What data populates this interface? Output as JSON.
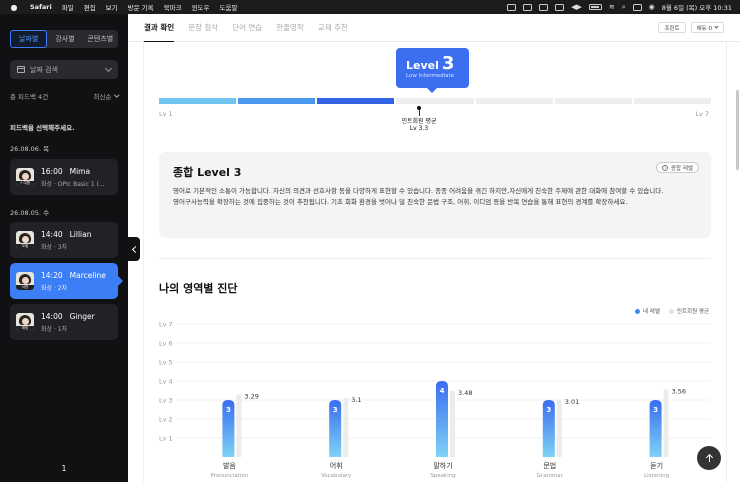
{
  "menubar": {
    "items": [
      "Safari",
      "파일",
      "편집",
      "보기",
      "방문 기록",
      "북마크",
      "윈도우",
      "도움말"
    ],
    "clock": "8월 6일 (목) 오후 10:31",
    "status_icons": [
      "screen-icon",
      "notebook-icon",
      "n-icon",
      "mail-icon",
      "playback-icon",
      "battery-icon",
      "wifi-icon",
      "search-icon",
      "control-center-icon",
      "siri-icon"
    ]
  },
  "sidebar": {
    "tabs": [
      "날짜별",
      "강사별",
      "콘텐츠별"
    ],
    "active_tab": "날짜별",
    "date_search": "날짜 검색",
    "total": "총 피드백 4건",
    "sort": "최신순",
    "hint": "피드백을 선택해주세요.",
    "groups": [
      {
        "date": "26.08.06. 목",
        "items": [
          {
            "time": "16:00",
            "name": "Mima",
            "sub": "화상 · OPIc Basic 1 (...",
            "tag": "⚡ 여명",
            "active": false
          }
        ]
      },
      {
        "date": "26.08.05. 수",
        "items": [
          {
            "time": "14:40",
            "name": "Lillian",
            "sub": "화상 · 3차",
            "tag": "오뒹",
            "active": false
          },
          {
            "time": "14:20",
            "name": "Marceline",
            "sub": "화상 · 2차",
            "tag": "서방",
            "active": true
          },
          {
            "time": "14:00",
            "name": "Ginger",
            "sub": "화상 · 1차",
            "tag": "래빙",
            "active": false
          }
        ]
      }
    ],
    "page": "1"
  },
  "main": {
    "tabs": [
      "결과 확인",
      "문장 첨삭",
      "단어 연습",
      "한줄영작",
      "교재 추천"
    ],
    "active_tab": "결과 확인",
    "print_button": "프린트",
    "lang_select": "에듀 0",
    "level": {
      "label": "Level",
      "number": "3",
      "desc": "Low Intermediate",
      "min": "Lv 1",
      "max": "Lv 7",
      "filled": 3,
      "total": 7,
      "avg_label": "민트회원 평균",
      "avg_value": "Lv 3.3"
    },
    "summary": {
      "title": "종합 Level 3",
      "tip": "종합 레벨",
      "p1": "영어로 기본적인 소통이 가능합니다. 자신의 의견과 선호사항 등을 다양하게 표현할 수 있습니다. 종종 어려움을 겪긴 하지만,자신에게 친숙한 주제에 관한 대화에 참여할 수 있습니다.",
      "p2": "영어구사능력을 확장하는 것에 집중하는 것이 추천됩니다. 기초 회화 환경을 벗어나 덜 친숙한 문법 구조, 어휘, 이디엄 등을 반복 연습을 통해 표현의 경계를 확장하세요."
    },
    "section_title": "나의 영역별 진단",
    "legend": {
      "mine": "내 레벨",
      "avg": "민트회원 평균"
    },
    "colors": {
      "accent": "#3b6ff0",
      "mine_top": "#3a6df0",
      "mine_bottom": "#7dd3f5",
      "avg": "#ececec"
    }
  },
  "chart_data": {
    "type": "bar",
    "categories": [
      "발음",
      "어휘",
      "말하기",
      "문법",
      "듣기"
    ],
    "sub_labels": [
      "Pronunciation",
      "Vocabulary",
      "Speaking",
      "Grammar",
      "Listening"
    ],
    "series": [
      {
        "name": "내 레벨",
        "values": [
          3,
          3,
          4,
          3,
          3
        ]
      },
      {
        "name": "민트회원 평균",
        "values": [
          3.29,
          3.1,
          3.48,
          3.01,
          3.56
        ]
      }
    ],
    "avg_labels": [
      "3.29",
      "3.1",
      "3.48",
      "3.01",
      "3.56"
    ],
    "y_ticks": [
      "Lv 1",
      "Lv 2",
      "Lv 3",
      "Lv 4",
      "Lv 5",
      "Lv 6",
      "Lv 7"
    ],
    "ylim": [
      0,
      7
    ],
    "grid": true,
    "legend": "top-right"
  }
}
